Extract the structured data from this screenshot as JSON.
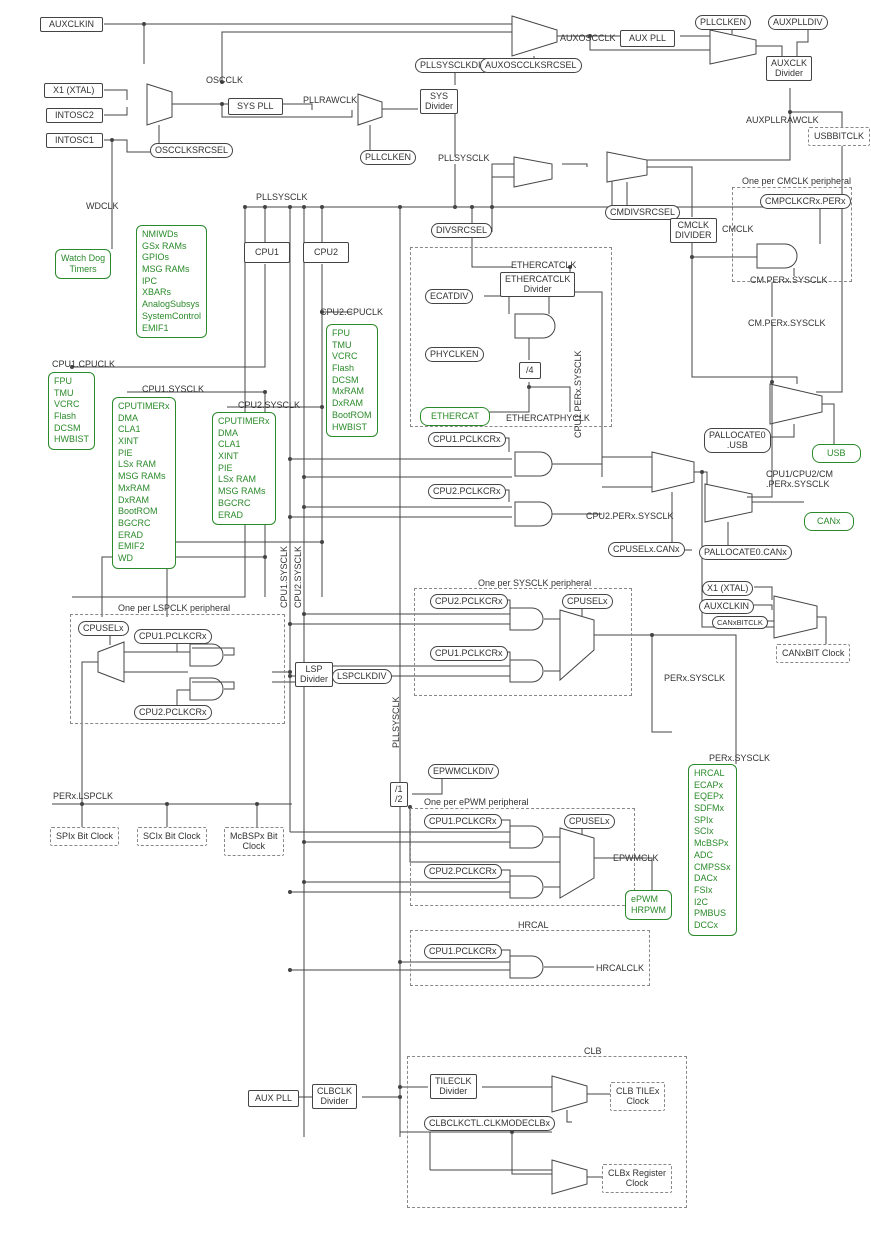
{
  "sources": {
    "auxclkin": "AUXCLKIN",
    "x1_xtal": "X1 (XTAL)",
    "intosc2": "INTOSC2",
    "intosc1": "INTOSC1"
  },
  "top": {
    "pllclken_r": "PLLCLKEN",
    "auxplldiv": "AUXPLLDIV",
    "aux_pll": "AUX PLL",
    "auxoscclk": "AUXOSCCLK",
    "auxclk_divider": "AUXCLK\nDivider",
    "pllsysclkdiv": "PLLSYSCLKDIV",
    "sys_divider": "SYS\nDivider",
    "auxoscclksrcsel": "AUXOSCCLKSRCSEL",
    "auxpllrawclk": "AUXPLLRAWCLK",
    "usbbitclk": "USBBITCLK",
    "oscclk": "OSCCLK",
    "sys_pll": "SYS PLL",
    "pllrawclk": "PLLRAWCLK",
    "oscclksrcsel": "OSCCLKSRCSEL",
    "pllclken_l": "PLLCLKEN",
    "pllsysclk": "PLLSYSCLK"
  },
  "wdclk": "WDCLK",
  "wdt_block": "Watch Dog\nTimers",
  "pllsysclk_label": "PLLSYSCLK",
  "cpu1": "CPU1",
  "cpu2": "CPU2",
  "divsrcsel": "DIVSRCSEL",
  "cmdivsrcsel": "CMDIVSRCSEL",
  "cmclk_divider": "CMCLK\nDIVIDER",
  "cmclk": "CMCLK",
  "one_per_cmclk": "One per CMCLK peripheral",
  "cmpclkcrx": "CMPCLKCRx.PERx",
  "nmi_group": "NMIWDs\nGSx RAMs\nGPIOs\nMSG RAMs\nIPC\nXBARs\nAnalogSubsys\nSystemControl\nEMIF1",
  "cpu2_cpuclk": "CPU2.CPUCLK",
  "cpu1_cpuclk": "CPU1.CPUCLK",
  "cpu1_sysclk": "CPU1.SYSCLK",
  "cpu2_sysclk": "CPU2.SYSCLK",
  "cpu1_group": "FPU\nTMU\nVCRC\nFlash\nDCSM\nHWBIST",
  "cpu2_group": "FPU\nTMU\nVCRC\nFlash\nDCSM\nMxRAM\nDxRAM\nBootROM\nHWBIST",
  "cpu1sys_group": "CPUTIMERx\nDMA\nCLA1\nXINT\nPIE\nLSx RAM\nMSG RAMs\nMxRAM\nDxRAM\nBootROM\nBGCRC\nERAD\nEMIF2\nWD",
  "cpu2sys_group": "CPUTIMERx\nDMA\nCLA1\nXINT\nPIE\nLSx RAM\nMSG RAMs\nBGCRC\nERAD",
  "ecat": {
    "ecatdiv": "ECATDIV",
    "ethercatclk": "ETHERCATCLK",
    "ethercatclk_div": "ETHERCATCLK\nDivider",
    "phyclken": "PHYCLKEN",
    "div4": "/4",
    "ethercat": "ETHERCAT",
    "ethercatphyclk": "ETHERCATPHYCLK"
  },
  "cm_perx_sysclk": "CM.PERx.SYSCLK",
  "pallocate_usb": "PALLOCATE0\n.USB",
  "usb": "USB",
  "cpu1_pclkcrx": "CPU1.PCLKCRx",
  "cpu2_pclkcrx": "CPU2.PCLKCRx",
  "cpu1_perx_sysclk": "CPU1.PERx.SYSCLK",
  "cpu2_perx_sysclk": "CPU2.PERx.SYSCLK",
  "cpu12cm_perx": "CPU1/CPU2/CM\n.PERx.SYSCLK",
  "canx": "CANx",
  "pallocate_canx": "PALLOCATE0.CANx",
  "cpuselx_canx": "CPUSELx.CANx",
  "x1_xtal2": "X1 (XTAL)",
  "auxclkin2": "AUXCLKIN",
  "canxbitclk": "CANxBITCLK",
  "canxbit_clock": "CANxBIT Clock",
  "cpu1_sysclk_v": "CPU1.SYSCLK",
  "cpu2_sysclk_v": "CPU2.SYSCLK",
  "pllsysclk_v": "PLLSYSCLK",
  "one_per_lspclk": "One per LSPCLK peripheral",
  "cpuselx": "CPUSELx",
  "lsp_divider": "LSP\nDivider",
  "lspclkdiv": "LSPCLKDIV",
  "one_per_sysclk": "One per SYSCLK peripheral",
  "cpuselx2": "CPUSELx",
  "perx_sysclk_r": "PERx.SYSCLK",
  "perx_sysclk_r2": "PERx.SYSCLK",
  "perx_lspclk": "PERx.LSPCLK",
  "spix_bit": "SPIx Bit Clock",
  "scix_bit": "SCIx Bit Clock",
  "mcbspx_bit": "McBSPx Bit\nClock",
  "epwmclkdiv": "EPWMCLKDIV",
  "div12": "/1\n/2",
  "one_per_epwm": "One per ePWM peripheral",
  "cpuselx3": "CPUSELx",
  "epwmclk": "EPWMCLK",
  "epwm_hrpwm": "ePWM\nHRPWM",
  "hrcal": "HRCAL",
  "hrcalclk": "HRCALCLK",
  "perx_group": "HRCAL\nECAPx\nEQEPx\nSDFMx\nSPIx\nSCIx\nMcBSPx\nADC\nCMPSSx\nDACx\nFSIx\nI2C\nPMBUS\nDCCx",
  "clb": "CLB",
  "aux_pll2": "AUX PLL",
  "clbclk_div": "CLBCLK\nDivider",
  "tileclk_div": "TILECLK\nDivider",
  "clbclkctl": "CLBCLKCTL.CLKMODECLBx",
  "clb_tilex": "CLB TILEx\nClock",
  "clbx_reg": "CLBx Register\nClock"
}
